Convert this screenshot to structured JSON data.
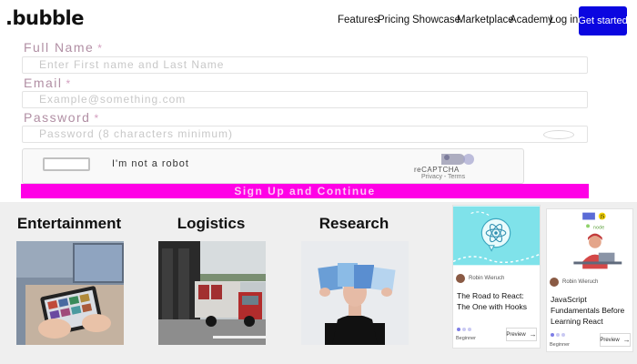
{
  "nav": {
    "logo": ".bubble",
    "links": [
      "Features",
      "Pricing",
      "Showcase",
      "Marketplace",
      "Academy",
      "Log in"
    ],
    "cta": "Get started"
  },
  "form": {
    "name_label": "Full Name",
    "name_placeholder": "Enter First name and Last Name",
    "email_label": "Email",
    "email_placeholder": "Example@something.com",
    "password_label": "Password",
    "password_placeholder": "Password (8 characters minimum)",
    "required_mark": "*",
    "captcha_text": "I'm not a robot",
    "captcha_brand": "reCAPTCHA",
    "captcha_links": "Privacy - Terms",
    "submit": "Sign Up and Continue"
  },
  "categories": [
    {
      "title": "Entertainment"
    },
    {
      "title": "Logistics"
    },
    {
      "title": "Research"
    }
  ],
  "cards": [
    {
      "author": "Robin Wieruch",
      "title": "The Road to React: The One with Hooks",
      "level": "Beginner",
      "preview": "Preview"
    },
    {
      "author": "Robin Wieruch",
      "title": "JavaScript Fundamentals Before Learning React",
      "level": "Beginner",
      "preview": "Preview",
      "badge": "JS",
      "img_text": "node"
    }
  ],
  "colors": {
    "accent": "#0b06e0",
    "submit": "#ff00e6",
    "label": "#b18fa4"
  }
}
